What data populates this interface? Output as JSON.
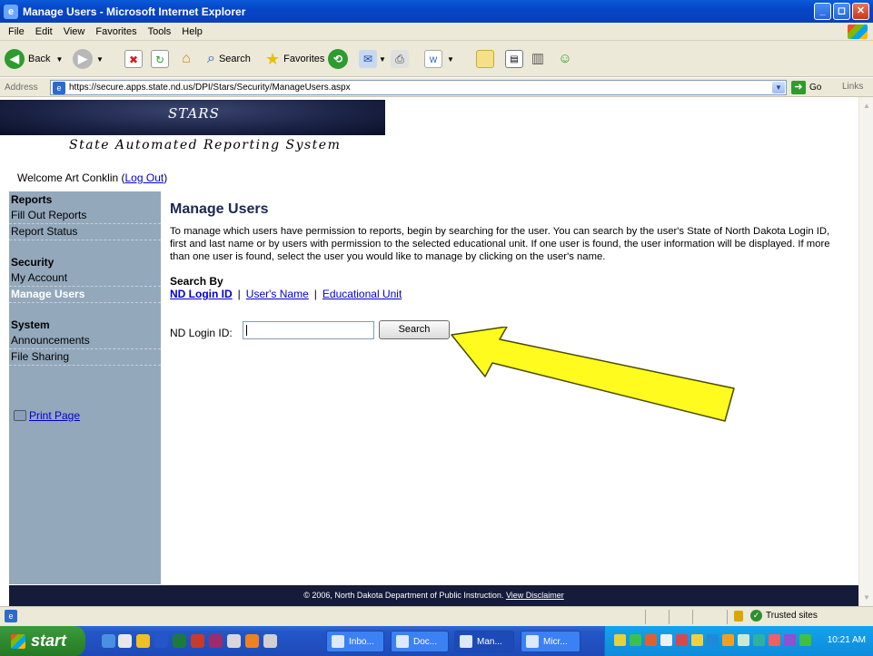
{
  "window": {
    "title": "Manage Users - Microsoft Internet Explorer"
  },
  "menu": [
    "File",
    "Edit",
    "View",
    "Favorites",
    "Tools",
    "Help"
  ],
  "toolbar": {
    "back": "Back",
    "search": "Search",
    "favorites": "Favorites"
  },
  "address": {
    "label": "Address",
    "url": "https://secure.apps.state.nd.us/DPI/Stars/Security/ManageUsers.aspx",
    "go": "Go",
    "links": "Links"
  },
  "page": {
    "banner": "STARS",
    "subtitle": "State Automated Reporting System",
    "welcome": "Welcome Art Conklin",
    "logout": "Log Out",
    "sidebar": {
      "reports_head": "Reports",
      "fill_out_reports": "Fill Out Reports",
      "report_status": "Report Status",
      "security_head": "Security",
      "my_account": "My Account",
      "manage_users": "Manage Users",
      "system_head": "System",
      "announcements": "Announcements",
      "file_sharing": "File Sharing",
      "print_page": "Print Page"
    },
    "title": "Manage Users",
    "intro": "To manage which users have permission to reports, begin by searching for the user. You can search by the user's State of North Dakota Login ID, first and last name or by users with permission to the selected educational unit. If one user is found, the user information will be displayed. If more than one user is found, select the user you would like to manage by clicking on the user's name.",
    "search_by_label": "Search By",
    "search_by": {
      "login_id": "ND Login ID",
      "users_name": "User's Name",
      "educational_unit": "Educational Unit",
      "separator": "|"
    },
    "login_label": "ND Login ID:",
    "login_value": "",
    "search_button": "Search",
    "footer": "© 2006, North Dakota Department of Public Instruction.",
    "footer_link": "View Disclaimer"
  },
  "statusbar": {
    "zone": "Trusted sites"
  },
  "taskbar": {
    "start": "start",
    "tasks": [
      "Inbo...",
      "Doc...",
      "Man...",
      "Micr..."
    ],
    "clock": "10:21 AM"
  }
}
